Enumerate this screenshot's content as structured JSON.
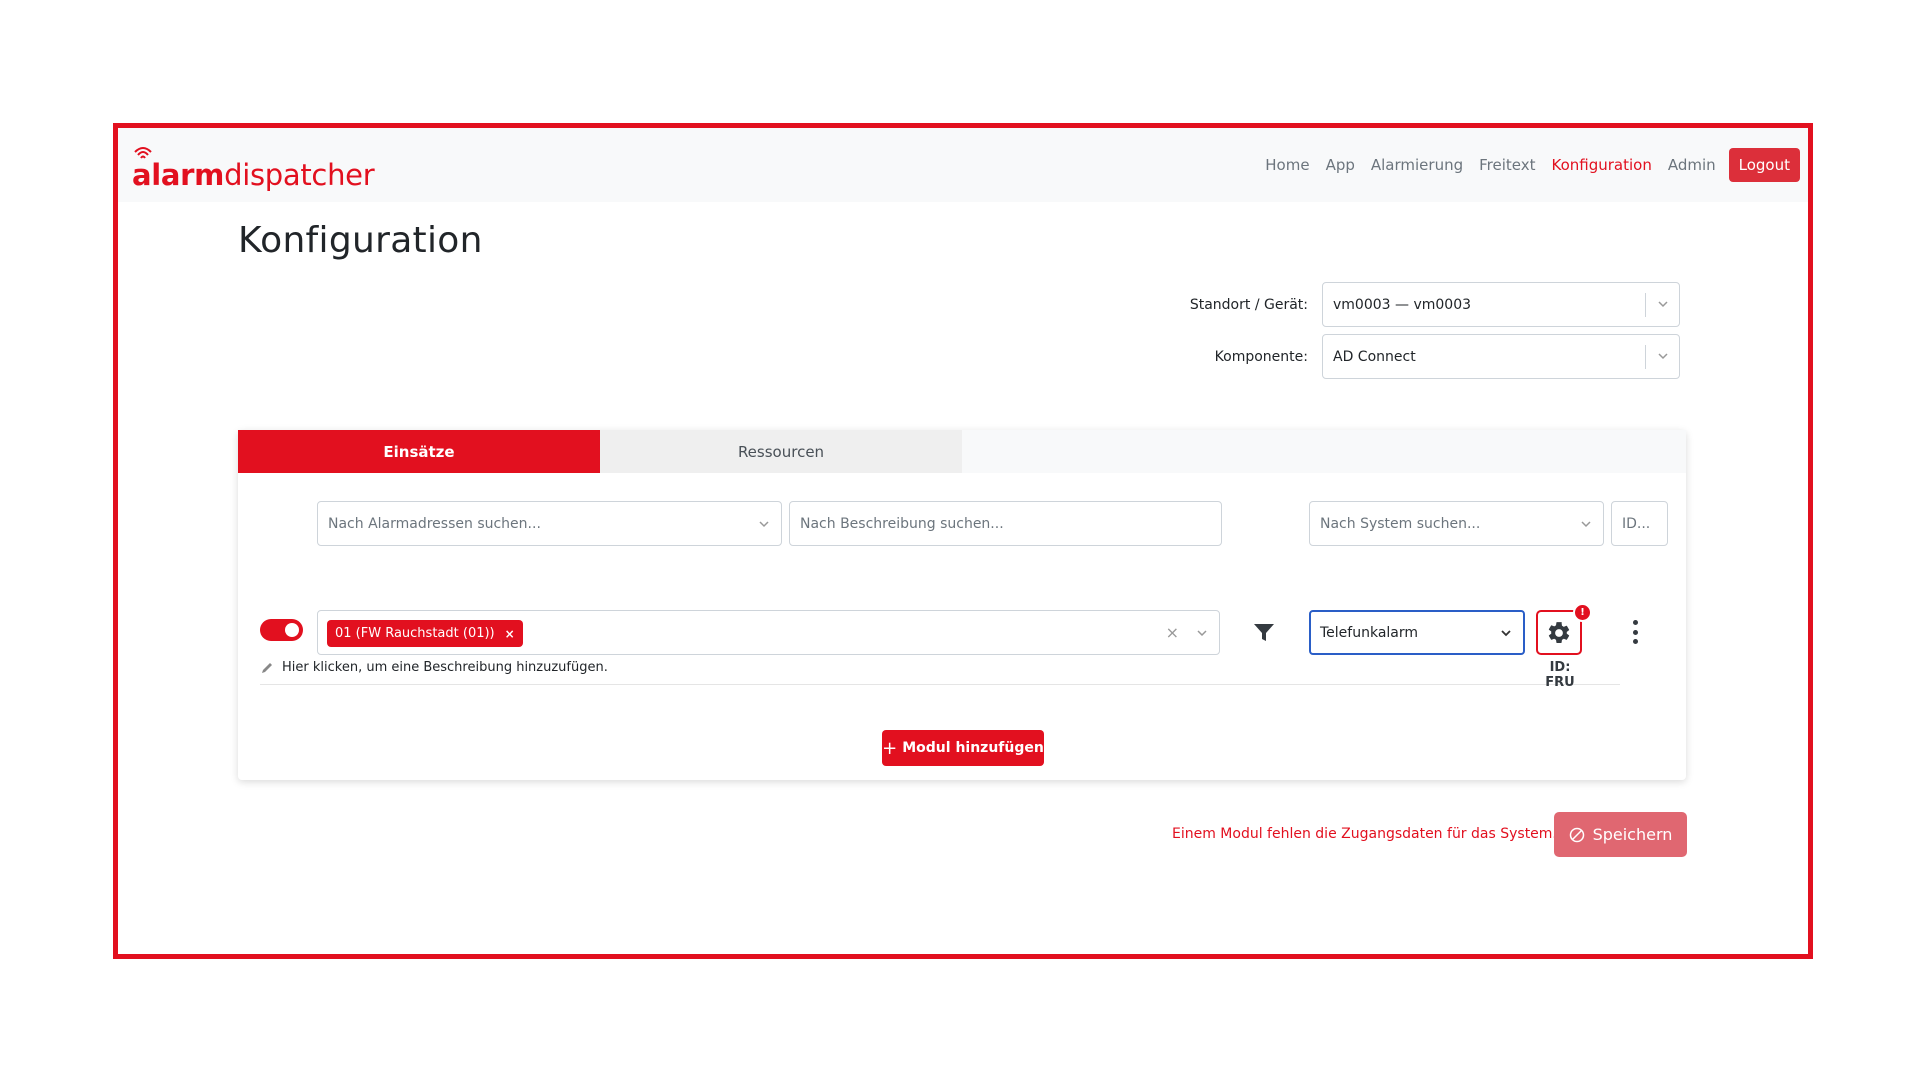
{
  "app": {
    "logo_bold": "alarm",
    "logo_light": "dispatcher"
  },
  "nav": {
    "items": [
      "Home",
      "App",
      "Alarmierung",
      "Freitext",
      "Konfiguration",
      "Admin"
    ],
    "active": "Konfiguration",
    "logout_label": "Logout"
  },
  "page": {
    "title": "Konfiguration"
  },
  "selectors": {
    "standort_label": "Standort / Gerät:",
    "standort_value": "vm0003 — vm0003",
    "komponente_label": "Komponente:",
    "komponente_value": "AD Connect"
  },
  "tabs": {
    "einsaetze": "Einsätze",
    "ressourcen": "Ressourcen"
  },
  "filters": {
    "alarmadressen_placeholder": "Nach Alarmadressen suchen...",
    "beschreibung_placeholder": "Nach Beschreibung suchen...",
    "system_placeholder": "Nach System suchen...",
    "id_placeholder": "ID..."
  },
  "module": {
    "enabled": true,
    "chip_label": "01 (FW Rauchstadt (01))",
    "chip_remove": "×",
    "clear": "×",
    "description_hint": "Hier klicken, um eine Beschreibung hinzuzufügen.",
    "system_value": "Telefunkalarm",
    "badge": "!",
    "id_label": "ID: FRU"
  },
  "actions": {
    "add_module_label": "Modul hinzufügen",
    "save_label": "Speichern",
    "warning_text": "Einem Modul fehlen die Zugangsdaten für das System."
  },
  "colors": {
    "brand": "#e2101f",
    "save_disabled": "#e06771",
    "focus_border": "#2a5ec7"
  }
}
